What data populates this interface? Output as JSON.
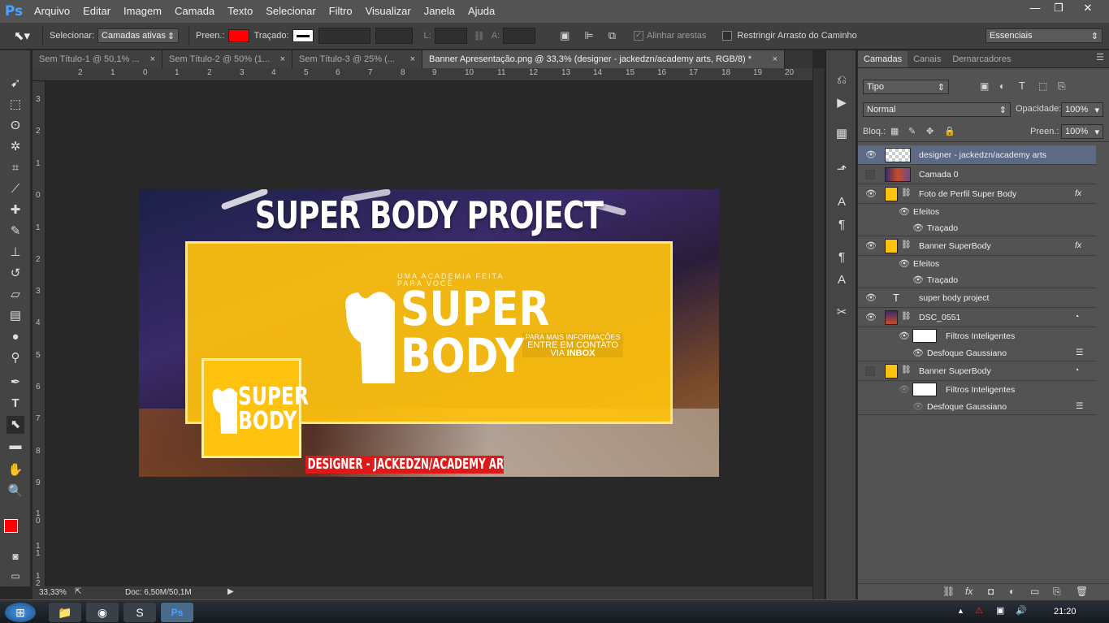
{
  "app": {
    "logo": "Ps",
    "menu": [
      "Arquivo",
      "Editar",
      "Imagem",
      "Camada",
      "Texto",
      "Selecionar",
      "Filtro",
      "Visualizar",
      "Janela",
      "Ajuda"
    ]
  },
  "window_controls": {
    "minimize": "—",
    "restore": "❐",
    "close": "✕"
  },
  "options": {
    "select_label": "Selecionar:",
    "select_value": "Camadas ativas",
    "fill_label": "Preen.:",
    "stroke_label": "Traçado:",
    "w_label": "L:",
    "h_label": "A:",
    "align_edges": "Alinhar arestas",
    "constrain": "Restringir Arrasto do Caminho",
    "workspace": "Essenciais",
    "fill_color": "#ff0000"
  },
  "tabs": [
    {
      "label": "Sem Título-1 @ 50,1% ...",
      "close": "×"
    },
    {
      "label": "Sem Título-2 @ 50% (1...",
      "close": "×"
    },
    {
      "label": "Sem Título-3 @ 25% (...",
      "close": "×"
    },
    {
      "label": "Banner Apresentação.png @ 33,3% (designer - jackedzn/academy arts, RGB/8) *",
      "close": "×"
    }
  ],
  "ruler": {
    "top": [
      "2",
      "1",
      "0",
      "1",
      "2",
      "3",
      "4",
      "5",
      "6",
      "7",
      "8",
      "9",
      "10",
      "11",
      "12",
      "13",
      "14",
      "15",
      "16",
      "17",
      "18",
      "19",
      "20"
    ],
    "left": [
      "3",
      "2",
      "1",
      "0",
      "1",
      "2",
      "3",
      "4",
      "5",
      "6",
      "7",
      "8",
      "9",
      "1 0",
      "1 1",
      "1 2"
    ]
  },
  "artwork": {
    "headline": "SUPER BODY PROJECT",
    "tagline": "UMA ACADEMIA FEITA PARA VOCÊ",
    "logo_top": "SUPER",
    "logo_bottom": "BODY",
    "info_line1": "PARA MAIS INFORMAÇÕES",
    "info_line2": "ENTRE EM CONTATO",
    "info_line3a": "VIA ",
    "info_line3b": "INBOX",
    "small_logo_top": "SUPER",
    "small_logo_bottom": "BODY",
    "credit": "DESIGNER - JACKEDZN/ACADEMY ARTS",
    "accent": "#ffc20e",
    "credit_bg": "#e01818"
  },
  "status": {
    "zoom": "33,33%",
    "doc": "Doc: 6,50M/50,1M"
  },
  "panel": {
    "tabs": [
      "Camadas",
      "Canais",
      "Demarcadores"
    ],
    "filter": "Tipo",
    "blend": "Normal",
    "opacity_label": "Opacidade:",
    "opacity": "100%",
    "lock_label": "Bloq.:",
    "fill_label": "Preen.:",
    "fill": "100%",
    "layers": [
      {
        "name": "designer - jackedzn/academy arts",
        "visible": true
      },
      {
        "name": "Camada 0",
        "visible": false
      },
      {
        "name": "Foto de Perfil Super Body",
        "visible": true,
        "fx": "fx"
      },
      {
        "name": "Efeitos"
      },
      {
        "name": "Traçado"
      },
      {
        "name": "Banner SuperBody",
        "visible": true,
        "fx": "fx"
      },
      {
        "name": "Efeitos"
      },
      {
        "name": "Traçado"
      },
      {
        "name": "super body project",
        "visible": true,
        "type": "T"
      },
      {
        "name": "DSC_0551",
        "visible": true
      },
      {
        "name": "Filtros Inteligentes"
      },
      {
        "name": "Desfoque Gaussiano"
      },
      {
        "name": "Banner SuperBody",
        "visible": false
      },
      {
        "name": "Filtros Inteligentes"
      },
      {
        "name": "Desfoque Gaussiano"
      }
    ]
  },
  "taskbar": {
    "time": "21:20"
  }
}
